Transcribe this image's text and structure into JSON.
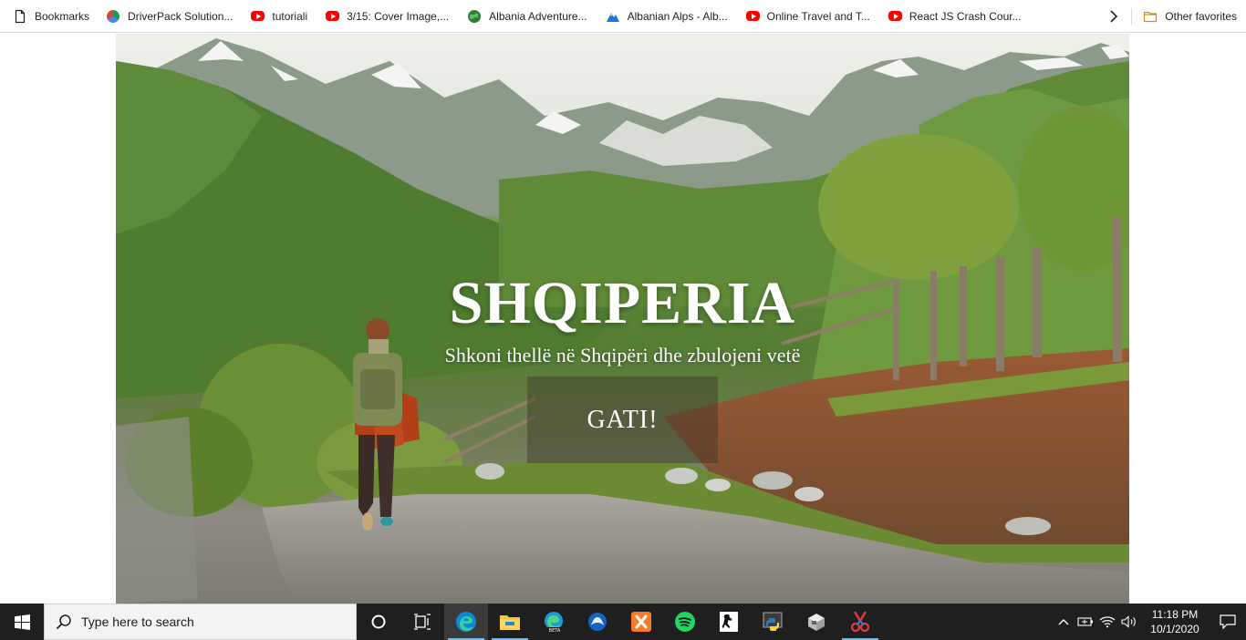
{
  "bookmarks": {
    "items": [
      {
        "label": "Bookmarks",
        "icon": "bookmark-page-icon"
      },
      {
        "label": "DriverPack Solution...",
        "icon": "driverpack-icon"
      },
      {
        "label": "tutoriali",
        "icon": "youtube-icon"
      },
      {
        "label": "3/15: Cover Image,...",
        "icon": "youtube-icon"
      },
      {
        "label": "Albania Adventure...",
        "icon": "globe-icon"
      },
      {
        "label": "Albanian Alps - Alb...",
        "icon": "mountain-icon"
      },
      {
        "label": "Online Travel and T...",
        "icon": "youtube-icon"
      },
      {
        "label": "React JS Crash Cour...",
        "icon": "youtube-icon"
      }
    ],
    "other_favorites": "Other favorites"
  },
  "hero": {
    "title": "SHQIPERIA",
    "subtitle": "Shkoni thellë në Shqipëri dhe zbulojeni vetë",
    "button_label": "GATI!"
  },
  "taskbar": {
    "search_placeholder": "Type here to search",
    "apps": [
      "cortana-icon",
      "task-view-icon",
      "edge-icon",
      "file-explorer-icon",
      "edge-beta-icon",
      "app-blue-icon",
      "xampp-icon",
      "spotify-icon",
      "game-icon",
      "python-icon",
      "vm-icon",
      "snipping-tool-icon"
    ],
    "clock": {
      "time": "11:18 PM",
      "date": "10/1/2020"
    }
  },
  "colors": {
    "taskbar_bg": "#1f1f1f",
    "youtube_red": "#ff0000",
    "hero_button_bg": "rgba(60,50,40,0.42)",
    "text_white": "#ffffff"
  }
}
